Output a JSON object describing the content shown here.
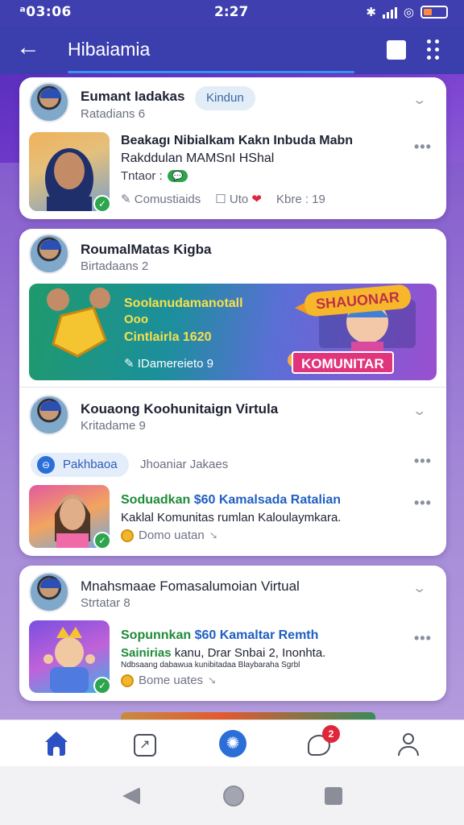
{
  "status_bar": {
    "time_left": "ᵃ03:06",
    "time_center": "2:27"
  },
  "app_bar": {
    "title": "Hibaiamia"
  },
  "cards": [
    {
      "name": "Eumant Iadakas",
      "subtitle": "Ratadians 6",
      "pill": "Kindun",
      "headline_1": "Beakagı Nibialkam Kakn Inbuda Mabn",
      "headline_2": "Rakddulan MAMSnI HShal",
      "tag": "Tntaor :",
      "chat_badge": "💬",
      "actions": {
        "comment": "Comustiaids",
        "like": "Uto",
        "share": "Kbre : 19"
      }
    },
    {
      "name": "RoumalMatas Kigba",
      "subtitle": "Birtadaans 2",
      "banner_line_1": "Soolanudamanotall",
      "banner_line_2": "Ooo",
      "banner_line_3": "Cintlairla 1620",
      "banner_meta": "IDamereieto",
      "banner_meta_2": "9",
      "banner_title": "SHAUONAR",
      "banner_button": "KOMUNITAR"
    },
    {
      "name": "Kouaong Koohunitaign Virtula",
      "subtitle": "Kritadame 9",
      "pill": "Pakhbaoa",
      "pill_secondary": "Jhoaniar Jakaes",
      "headline_green": "Soduadkan",
      "headline_blue": "$60 Kamalsada Ratalian",
      "body": "Kaklal Komunitas rumlan Kaloulaymkara.",
      "meta": "Domo uatan"
    },
    {
      "name": "Mnahsmaae Fomasalumoian Virtual",
      "subtitle": "Strtatar 8",
      "headline_green": "Sopunnkan",
      "headline_blue": "$60 Kamaltar Remth",
      "body_green": "Sainirias",
      "body": "kanu, Drar Snbai 2, Inonhta.",
      "body_small": "Ndbsaang dabawua kunibitadaa Blaybaraha Sgrbl",
      "meta": "Bome uates"
    }
  ],
  "bottom_nav": {
    "notification_count": "2"
  },
  "colors": {
    "app_bar": "#3b3fae",
    "accent": "#2b51c2",
    "green": "#1f8b3a",
    "badge_red": "#e0263a"
  }
}
